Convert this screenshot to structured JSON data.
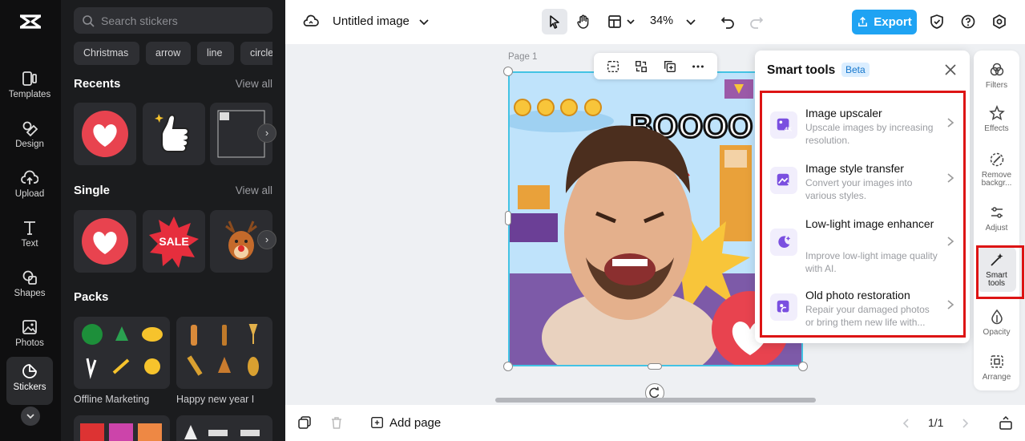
{
  "rail": {
    "items": [
      {
        "label": "Templates",
        "icon": "templates-icon"
      },
      {
        "label": "Design",
        "icon": "design-icon"
      },
      {
        "label": "Upload",
        "icon": "upload-icon"
      },
      {
        "label": "Text",
        "icon": "text-icon"
      },
      {
        "label": "Shapes",
        "icon": "shapes-icon"
      },
      {
        "label": "Photos",
        "icon": "photos-icon"
      },
      {
        "label": "Stickers",
        "icon": "stickers-icon",
        "active": true
      }
    ]
  },
  "stickers": {
    "search_placeholder": "Search stickers",
    "chips": [
      "Christmas",
      "arrow",
      "line",
      "circle"
    ],
    "recents": {
      "title": "Recents",
      "view_all": "View all"
    },
    "single": {
      "title": "Single",
      "view_all": "View all",
      "tiles": [
        "SALE"
      ]
    },
    "packs": {
      "title": "Packs",
      "items": [
        "Offline Marketing",
        "Happy new year I"
      ]
    }
  },
  "topbar": {
    "title": "Untitled image",
    "zoom": "34%",
    "export_label": "Export"
  },
  "canvas": {
    "page_label": "Page 1",
    "artwork_text": "BOOOO"
  },
  "smart_tools": {
    "title": "Smart tools",
    "badge": "Beta",
    "tools": [
      {
        "name": "Image upscaler",
        "desc": "Upscale images by increasing resolution.",
        "icon": "upscale-4k-icon"
      },
      {
        "name": "Image style transfer",
        "desc": "Convert your images into various styles.",
        "icon": "style-transfer-icon"
      },
      {
        "name": "Low-light image enhancer",
        "desc": "Improve low-light image quality with AI.",
        "icon": "moon-sparkle-icon"
      },
      {
        "name": "Old photo restoration",
        "desc": "Repair your damaged photos or bring them new life with...",
        "icon": "photo-restore-icon"
      }
    ]
  },
  "right_rail": {
    "items": [
      {
        "label": "Filters",
        "icon": "filters-icon"
      },
      {
        "label": "Effects",
        "icon": "effects-icon"
      },
      {
        "label": "Remove backgr...",
        "icon": "remove-background-icon"
      },
      {
        "label": "Adjust",
        "icon": "adjust-icon"
      },
      {
        "label": "Smart tools",
        "icon": "magic-wand-icon",
        "active": true
      },
      {
        "label": "Opacity",
        "icon": "opacity-icon"
      },
      {
        "label": "Arrange",
        "icon": "arrange-icon"
      }
    ]
  },
  "bottom": {
    "add_page": "Add page",
    "page_indicator": "1/1"
  },
  "colors": {
    "accent": "#1fa3f3",
    "highlight": "#dd1414",
    "selection": "#43c3e4"
  }
}
